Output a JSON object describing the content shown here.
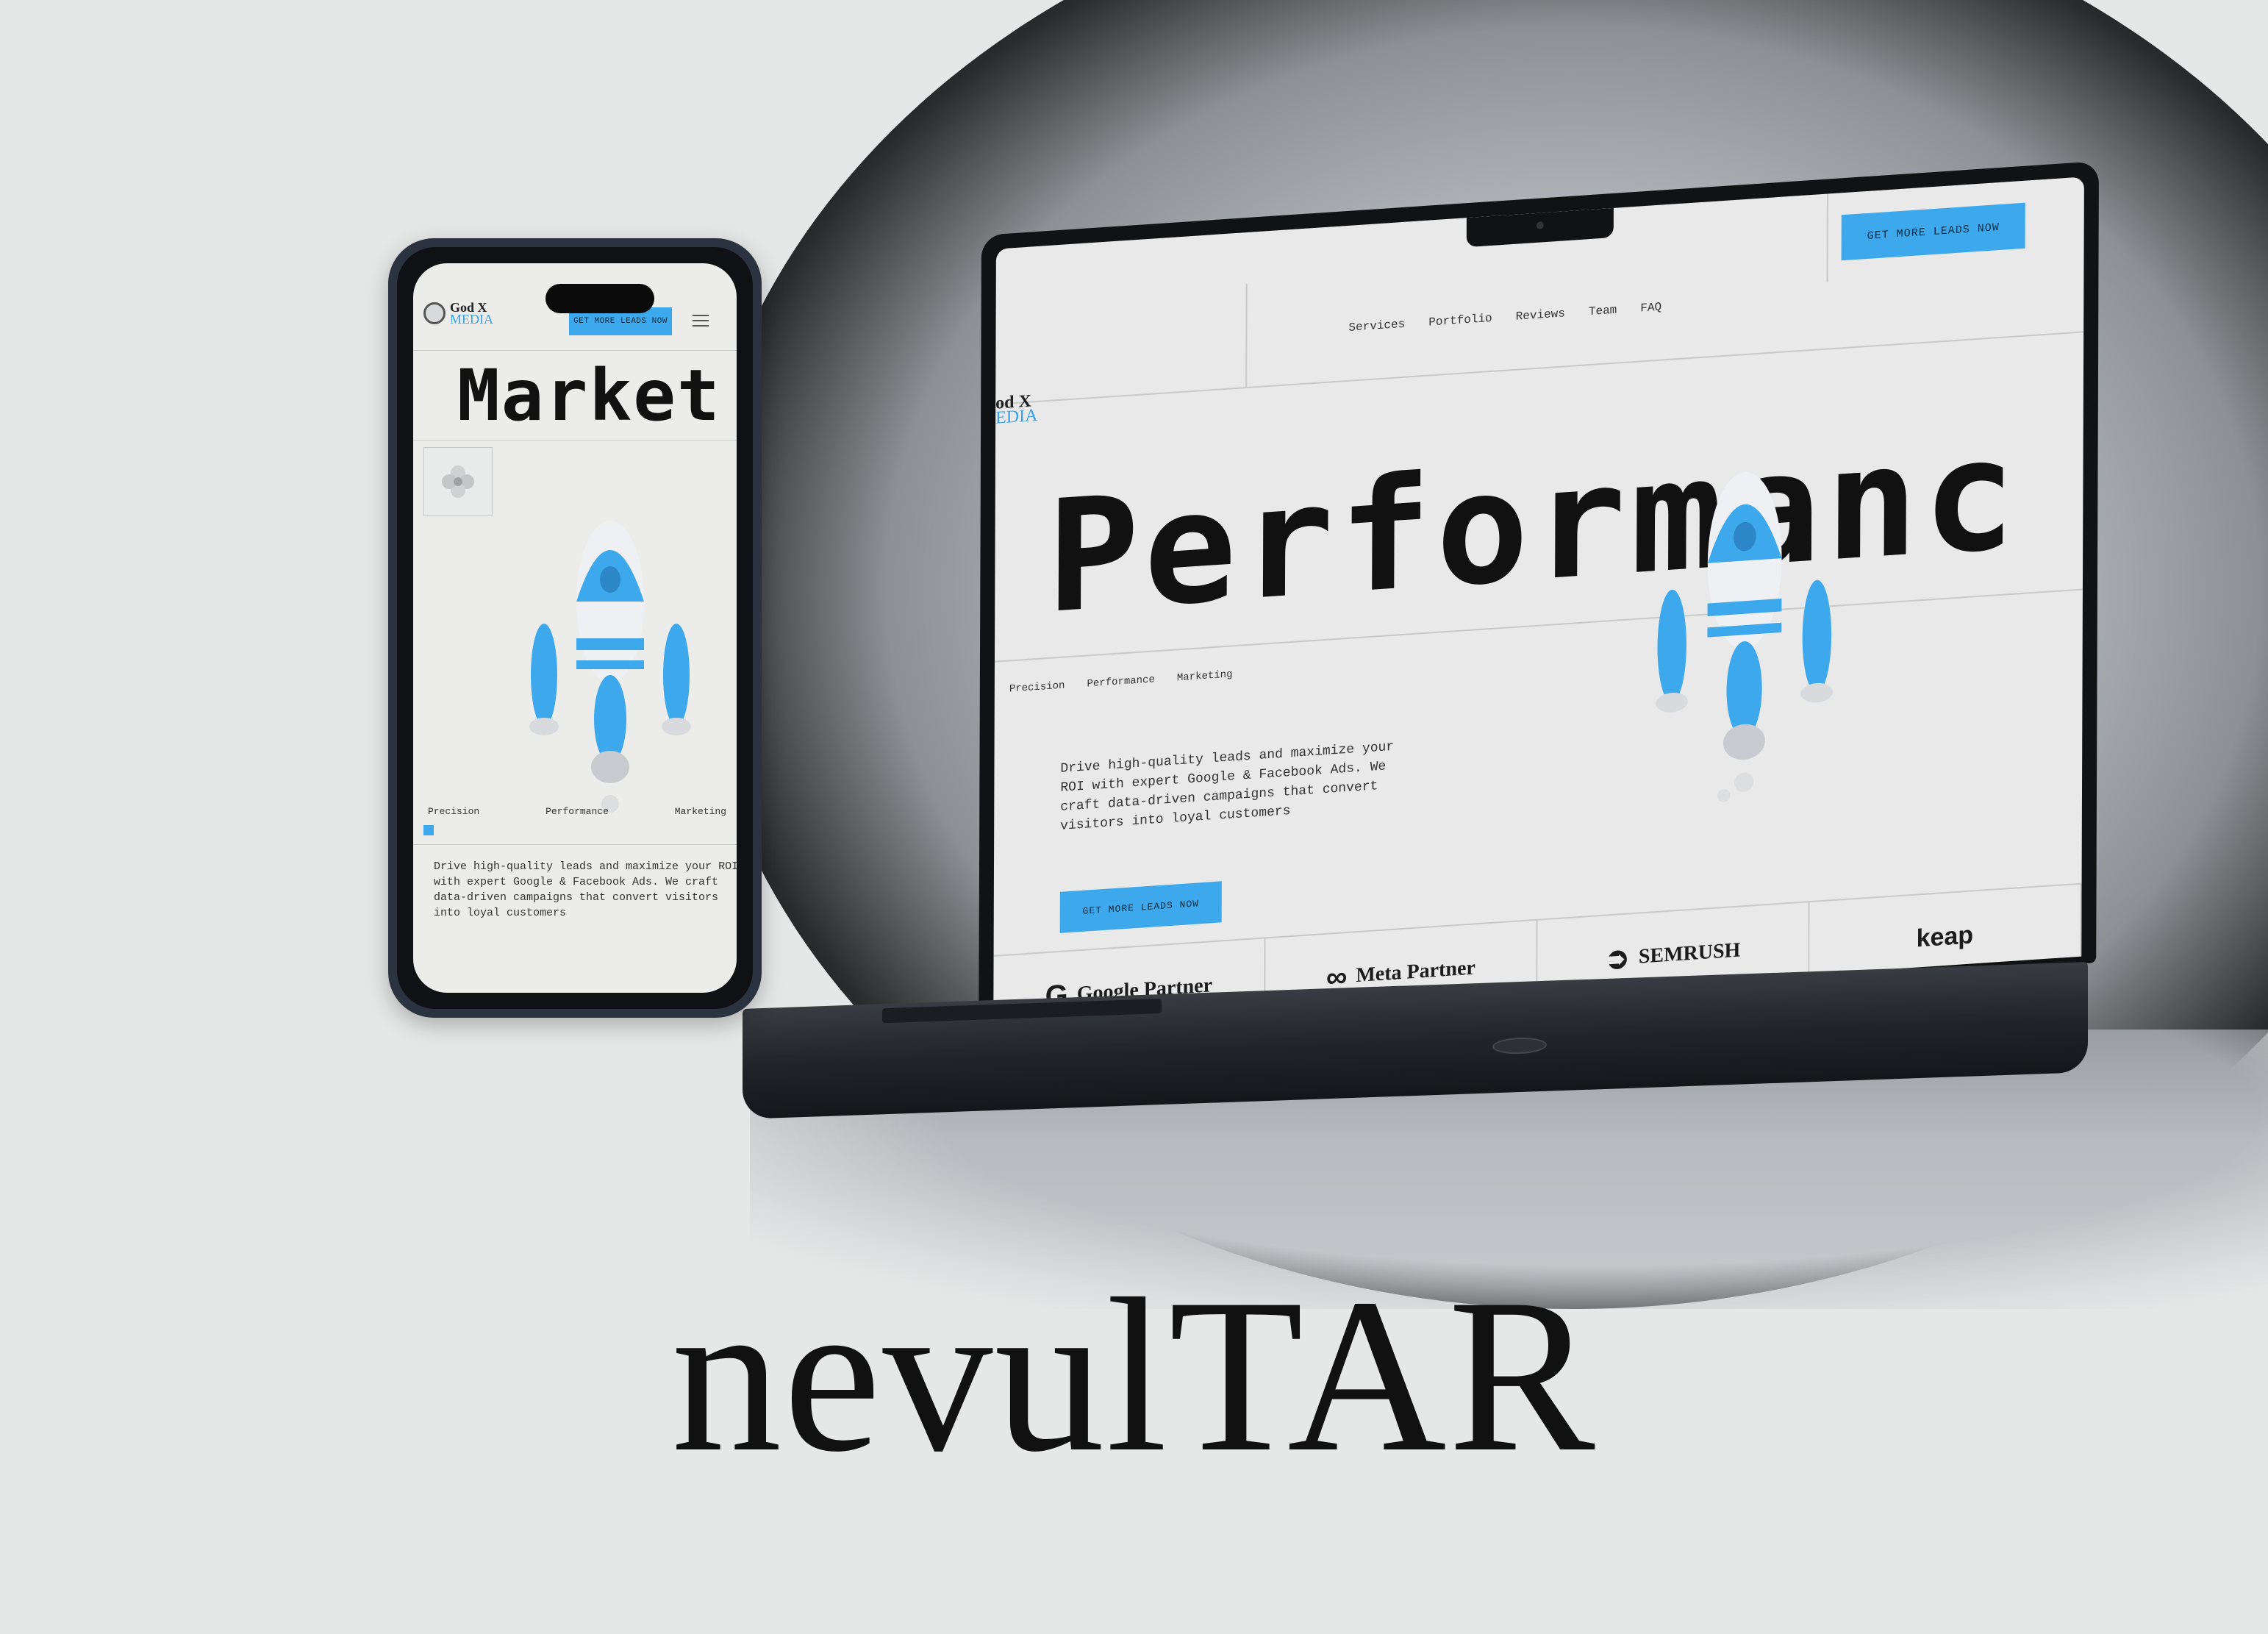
{
  "brand": "nevulTAR",
  "phone": {
    "logo_line1": "God X",
    "logo_line2": "MEDIA",
    "cta": "GET MORE LEADS NOW",
    "headline": "Market",
    "tags": [
      "Precision",
      "Performance",
      "Marketing"
    ],
    "body": "Drive high-quality leads and maximize your ROI with expert Google & Facebook Ads. We craft data-driven campaigns that convert visitors into loyal customers"
  },
  "laptop": {
    "logo_line1": "od X",
    "logo_line2": "EDIA",
    "nav": [
      "Services",
      "Portfolio",
      "Reviews",
      "Team",
      "FAQ"
    ],
    "cta": "GET MORE LEADS NOW",
    "headline": "Performanc",
    "tags": [
      "Precision",
      "Performance",
      "Marketing"
    ],
    "body": "Drive high-quality leads and maximize your ROI with expert Google & Facebook Ads. We craft data-driven campaigns that convert visitors into loyal customers",
    "cta2": "GET MORE LEADS NOW",
    "partners": [
      {
        "glyph": "G",
        "label": "Google Partner"
      },
      {
        "glyph": "∞",
        "label": "Meta Partner"
      },
      {
        "glyph": "➲",
        "label": "SEMRUSH"
      },
      {
        "glyph": "",
        "label": "keap"
      }
    ]
  },
  "colors": {
    "accent": "#3ea8ec",
    "background": "#e6e7e7",
    "text": "#111111"
  }
}
